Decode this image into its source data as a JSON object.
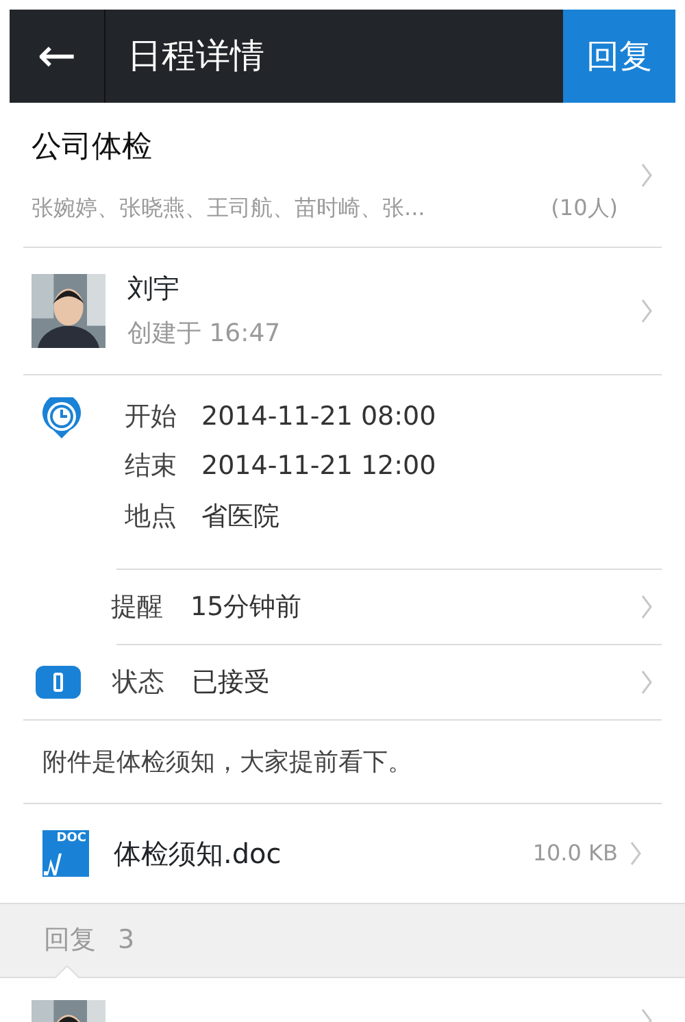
{
  "header": {
    "back": "←",
    "title": "日程详情",
    "action": "回复"
  },
  "event": {
    "title": "公司体检",
    "attendees": "张婉婷、张晓燕、王司航、苗时崎、张...",
    "attendee_count": "(10人)"
  },
  "creator": {
    "name": "刘宇",
    "created": "创建于 16:47"
  },
  "details": [
    {
      "label": "开始",
      "value": "2014-11-21 08:00"
    },
    {
      "label": "结束",
      "value": "2014-11-21 12:00"
    },
    {
      "label": "地点",
      "value": "省医院"
    }
  ],
  "reminder": {
    "label": "提醒",
    "value": "15分钟前"
  },
  "status": {
    "label": "状态",
    "value": "已接受"
  },
  "note": "附件是体检须知，大家提前看下。",
  "attachment": {
    "icon_label": "DOC",
    "name": "体检须知.doc",
    "size": "10.0 KB"
  },
  "replies": {
    "label": "回复",
    "count": "3"
  }
}
